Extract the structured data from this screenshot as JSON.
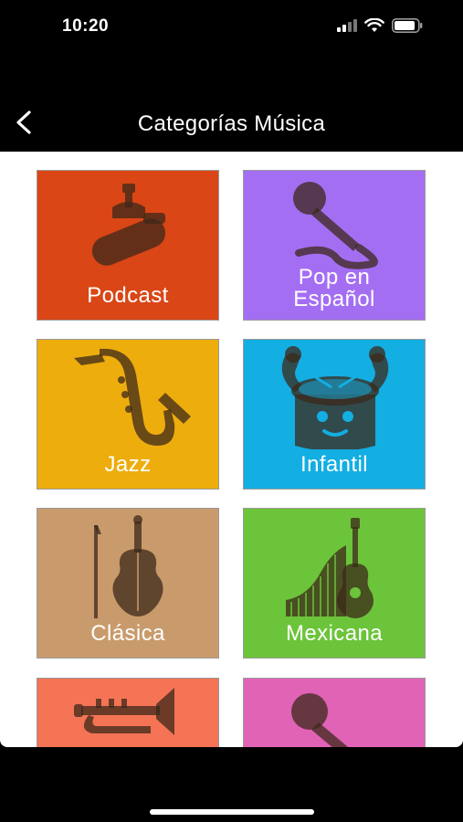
{
  "status": {
    "time": "10:20"
  },
  "nav": {
    "title": "Categorías Música"
  },
  "colors": {
    "podcast": "#DA4616",
    "pop": "#A46EF3",
    "jazz": "#EDAD0D",
    "infantil": "#13AEE2",
    "clasica": "#C99B6C",
    "mexicana": "#6CC43A",
    "row4_left": "#F57455",
    "row4_right": "#E163B6",
    "icon_shade": "rgba(60,40,25,0.75)"
  },
  "categories": [
    {
      "label": "Podcast",
      "icon": "podcast-microphone-icon"
    },
    {
      "label_line1": "Pop en",
      "label_line2": "Español",
      "icon": "handheld-microphone-icon"
    },
    {
      "label": "Jazz",
      "icon": "saxophone-icon"
    },
    {
      "label": "Infantil",
      "icon": "cartoon-drum-icon"
    },
    {
      "label": "Clásica",
      "icon": "violin-icon"
    },
    {
      "label": "Mexicana",
      "icon": "guitar-sarape-icon"
    },
    {
      "label": "",
      "icon": "trumpet-icon"
    },
    {
      "label": "",
      "icon": "microphone-icon"
    }
  ]
}
